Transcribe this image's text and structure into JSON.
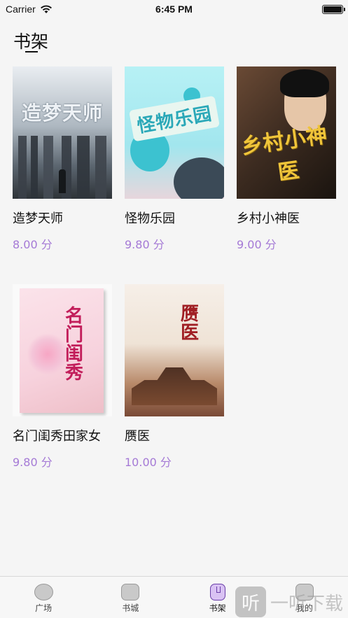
{
  "status_bar": {
    "carrier": "Carrier",
    "time": "6:45 PM"
  },
  "header": {
    "title": "书架"
  },
  "books": [
    {
      "name": "造梦天师",
      "score": "8.00 分",
      "cover_text": "造梦天师"
    },
    {
      "name": "怪物乐园",
      "score": "9.80 分",
      "cover_text": "怪物乐园"
    },
    {
      "name": "乡村小神医",
      "score": "9.00 分",
      "cover_text": "乡村小神医"
    },
    {
      "name": "名门闺秀田家女",
      "score": "9.80 分",
      "cover_text": "名门闺秀"
    },
    {
      "name": "赝医",
      "score": "10.00 分",
      "cover_text": "赝医"
    }
  ],
  "tabbar": {
    "tabs": [
      {
        "label": "广场",
        "icon": "square-icon"
      },
      {
        "label": "书城",
        "icon": "bookstore-icon"
      },
      {
        "label": "书架",
        "icon": "bookshelf-icon",
        "active": true
      },
      {
        "label": "我的",
        "icon": "profile-icon"
      }
    ]
  },
  "watermark": {
    "glyph": "听",
    "text": "一听下载"
  },
  "colors": {
    "accent": "#a57ad6",
    "background": "#f5f5f5"
  }
}
